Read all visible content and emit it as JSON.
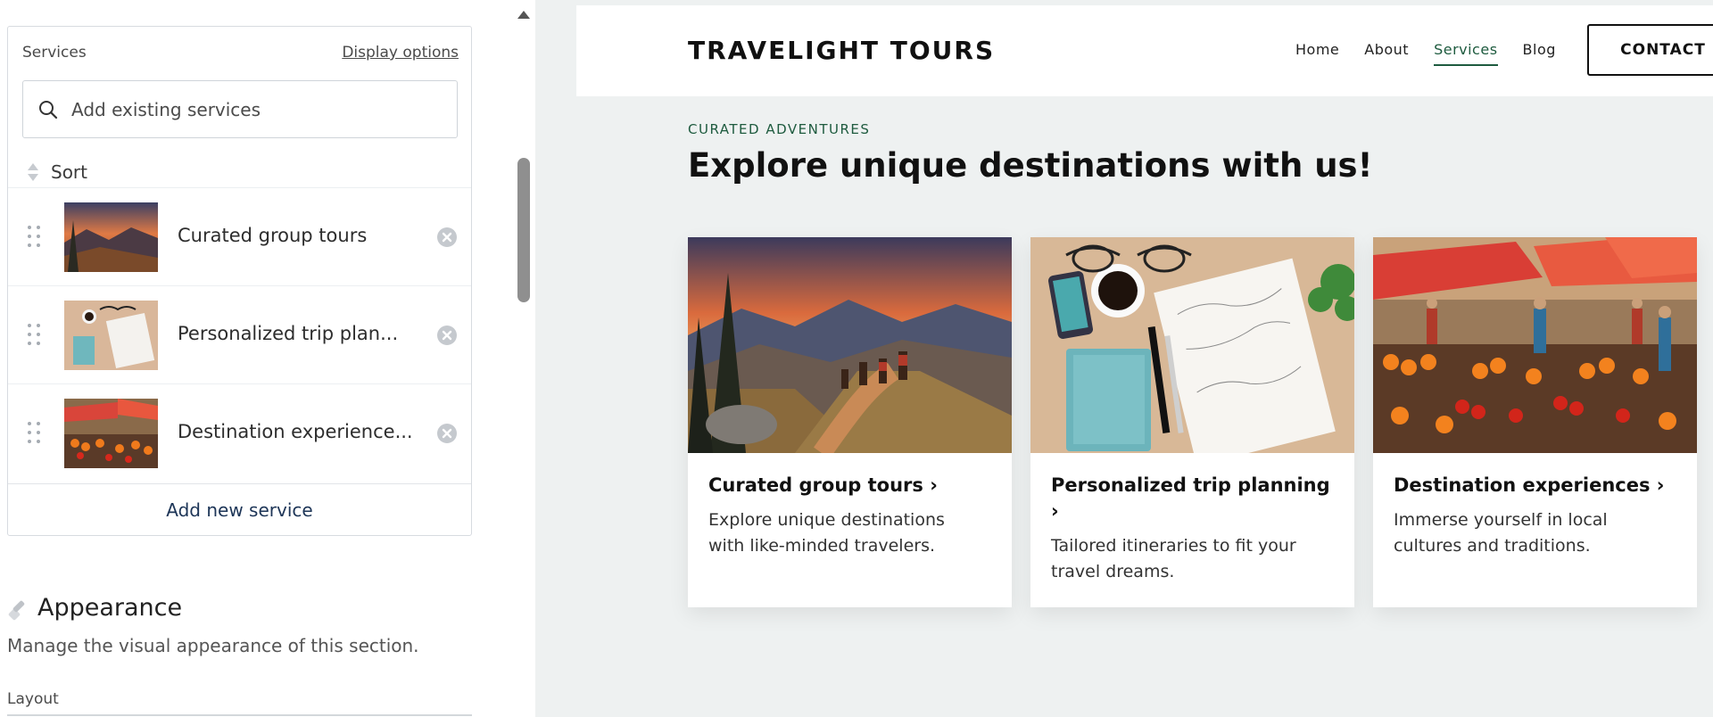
{
  "editor": {
    "services_label": "Services",
    "display_options": "Display options",
    "search_placeholder": "Add existing services",
    "sort_label": "Sort",
    "items": [
      {
        "label": "Curated group tours"
      },
      {
        "label": "Personalized trip plan..."
      },
      {
        "label": "Destination experience..."
      }
    ],
    "add_new": "Add new service",
    "appearance_title": "Appearance",
    "appearance_desc": "Manage the visual appearance of this section.",
    "layout_label": "Layout"
  },
  "site": {
    "brand": "TRAVELIGHT TOURS",
    "nav": [
      "Home",
      "About",
      "Services",
      "Blog"
    ],
    "active_nav": "Services",
    "contact": "CONTACT",
    "eyebrow": "CURATED ADVENTURES",
    "headline": "Explore unique destinations with us!",
    "cards": [
      {
        "title": "Curated group tours ›",
        "desc": "Explore unique destinations with like-minded travelers."
      },
      {
        "title": "Personalized trip planning ›",
        "desc": "Tailored itineraries to fit your travel dreams."
      },
      {
        "title": "Destination experiences ›",
        "desc": "Immerse yourself in local cultures and traditions."
      }
    ]
  },
  "colors": {
    "accent_green": "#1e5b3f",
    "link_navy": "#1d3557"
  }
}
